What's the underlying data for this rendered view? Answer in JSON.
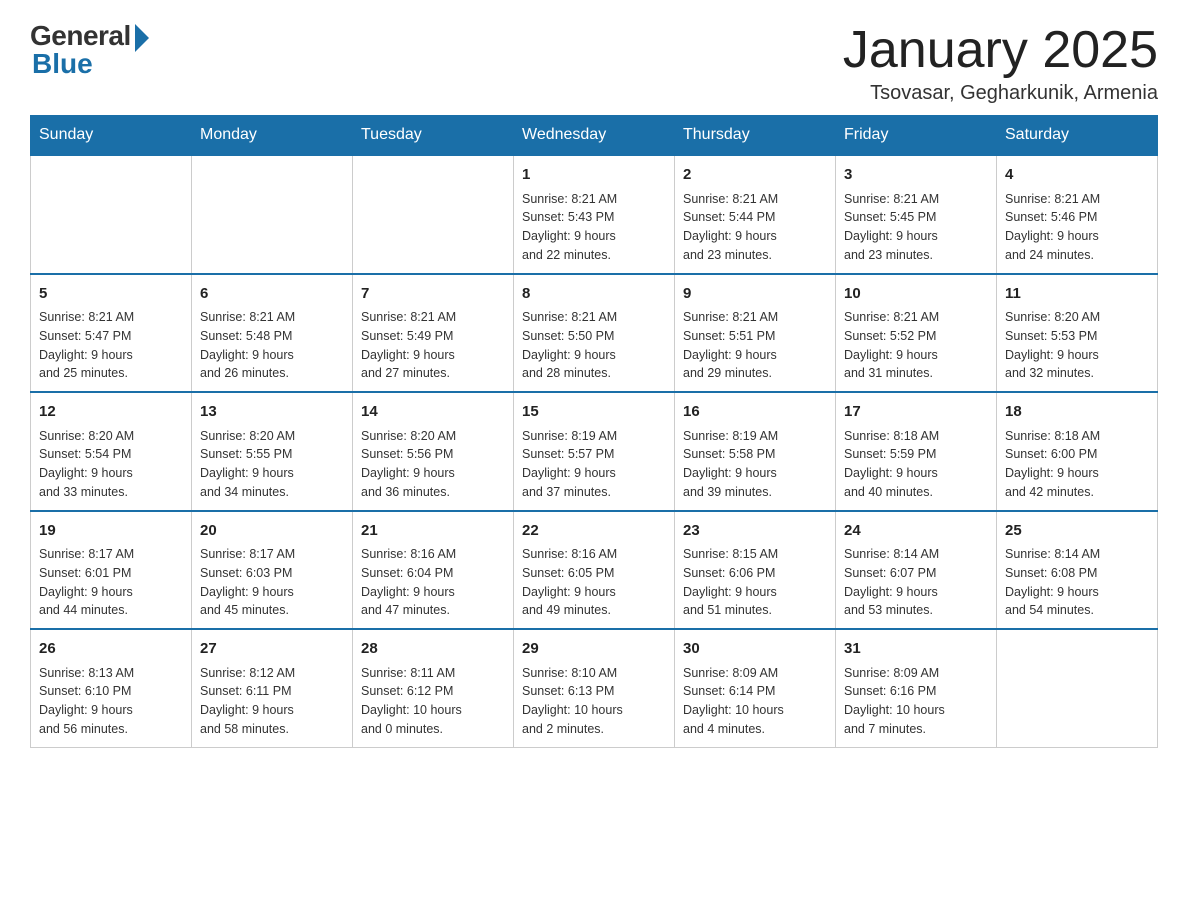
{
  "logo": {
    "general": "General",
    "blue": "Blue"
  },
  "header": {
    "month_title": "January 2025",
    "location": "Tsovasar, Gegharkunik, Armenia"
  },
  "days_of_week": [
    "Sunday",
    "Monday",
    "Tuesday",
    "Wednesday",
    "Thursday",
    "Friday",
    "Saturday"
  ],
  "weeks": [
    [
      {
        "day": "",
        "info": ""
      },
      {
        "day": "",
        "info": ""
      },
      {
        "day": "",
        "info": ""
      },
      {
        "day": "1",
        "info": "Sunrise: 8:21 AM\nSunset: 5:43 PM\nDaylight: 9 hours\nand 22 minutes."
      },
      {
        "day": "2",
        "info": "Sunrise: 8:21 AM\nSunset: 5:44 PM\nDaylight: 9 hours\nand 23 minutes."
      },
      {
        "day": "3",
        "info": "Sunrise: 8:21 AM\nSunset: 5:45 PM\nDaylight: 9 hours\nand 23 minutes."
      },
      {
        "day": "4",
        "info": "Sunrise: 8:21 AM\nSunset: 5:46 PM\nDaylight: 9 hours\nand 24 minutes."
      }
    ],
    [
      {
        "day": "5",
        "info": "Sunrise: 8:21 AM\nSunset: 5:47 PM\nDaylight: 9 hours\nand 25 minutes."
      },
      {
        "day": "6",
        "info": "Sunrise: 8:21 AM\nSunset: 5:48 PM\nDaylight: 9 hours\nand 26 minutes."
      },
      {
        "day": "7",
        "info": "Sunrise: 8:21 AM\nSunset: 5:49 PM\nDaylight: 9 hours\nand 27 minutes."
      },
      {
        "day": "8",
        "info": "Sunrise: 8:21 AM\nSunset: 5:50 PM\nDaylight: 9 hours\nand 28 minutes."
      },
      {
        "day": "9",
        "info": "Sunrise: 8:21 AM\nSunset: 5:51 PM\nDaylight: 9 hours\nand 29 minutes."
      },
      {
        "day": "10",
        "info": "Sunrise: 8:21 AM\nSunset: 5:52 PM\nDaylight: 9 hours\nand 31 minutes."
      },
      {
        "day": "11",
        "info": "Sunrise: 8:20 AM\nSunset: 5:53 PM\nDaylight: 9 hours\nand 32 minutes."
      }
    ],
    [
      {
        "day": "12",
        "info": "Sunrise: 8:20 AM\nSunset: 5:54 PM\nDaylight: 9 hours\nand 33 minutes."
      },
      {
        "day": "13",
        "info": "Sunrise: 8:20 AM\nSunset: 5:55 PM\nDaylight: 9 hours\nand 34 minutes."
      },
      {
        "day": "14",
        "info": "Sunrise: 8:20 AM\nSunset: 5:56 PM\nDaylight: 9 hours\nand 36 minutes."
      },
      {
        "day": "15",
        "info": "Sunrise: 8:19 AM\nSunset: 5:57 PM\nDaylight: 9 hours\nand 37 minutes."
      },
      {
        "day": "16",
        "info": "Sunrise: 8:19 AM\nSunset: 5:58 PM\nDaylight: 9 hours\nand 39 minutes."
      },
      {
        "day": "17",
        "info": "Sunrise: 8:18 AM\nSunset: 5:59 PM\nDaylight: 9 hours\nand 40 minutes."
      },
      {
        "day": "18",
        "info": "Sunrise: 8:18 AM\nSunset: 6:00 PM\nDaylight: 9 hours\nand 42 minutes."
      }
    ],
    [
      {
        "day": "19",
        "info": "Sunrise: 8:17 AM\nSunset: 6:01 PM\nDaylight: 9 hours\nand 44 minutes."
      },
      {
        "day": "20",
        "info": "Sunrise: 8:17 AM\nSunset: 6:03 PM\nDaylight: 9 hours\nand 45 minutes."
      },
      {
        "day": "21",
        "info": "Sunrise: 8:16 AM\nSunset: 6:04 PM\nDaylight: 9 hours\nand 47 minutes."
      },
      {
        "day": "22",
        "info": "Sunrise: 8:16 AM\nSunset: 6:05 PM\nDaylight: 9 hours\nand 49 minutes."
      },
      {
        "day": "23",
        "info": "Sunrise: 8:15 AM\nSunset: 6:06 PM\nDaylight: 9 hours\nand 51 minutes."
      },
      {
        "day": "24",
        "info": "Sunrise: 8:14 AM\nSunset: 6:07 PM\nDaylight: 9 hours\nand 53 minutes."
      },
      {
        "day": "25",
        "info": "Sunrise: 8:14 AM\nSunset: 6:08 PM\nDaylight: 9 hours\nand 54 minutes."
      }
    ],
    [
      {
        "day": "26",
        "info": "Sunrise: 8:13 AM\nSunset: 6:10 PM\nDaylight: 9 hours\nand 56 minutes."
      },
      {
        "day": "27",
        "info": "Sunrise: 8:12 AM\nSunset: 6:11 PM\nDaylight: 9 hours\nand 58 minutes."
      },
      {
        "day": "28",
        "info": "Sunrise: 8:11 AM\nSunset: 6:12 PM\nDaylight: 10 hours\nand 0 minutes."
      },
      {
        "day": "29",
        "info": "Sunrise: 8:10 AM\nSunset: 6:13 PM\nDaylight: 10 hours\nand 2 minutes."
      },
      {
        "day": "30",
        "info": "Sunrise: 8:09 AM\nSunset: 6:14 PM\nDaylight: 10 hours\nand 4 minutes."
      },
      {
        "day": "31",
        "info": "Sunrise: 8:09 AM\nSunset: 6:16 PM\nDaylight: 10 hours\nand 7 minutes."
      },
      {
        "day": "",
        "info": ""
      }
    ]
  ]
}
